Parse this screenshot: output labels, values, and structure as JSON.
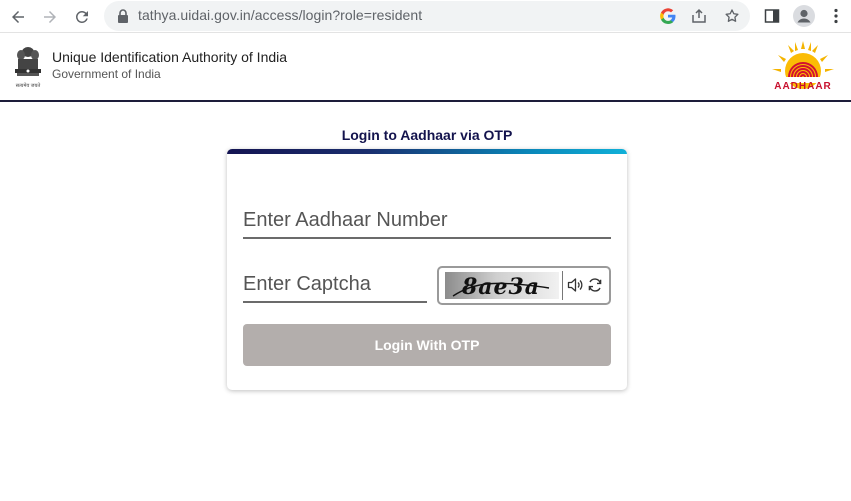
{
  "browser": {
    "url": "tathya.uidai.gov.in/access/login?role=resident",
    "icons": [
      "back-icon",
      "forward-icon",
      "reload-icon",
      "lock-icon",
      "google-icon",
      "share-icon",
      "star-icon",
      "side-panel-icon",
      "profile-icon",
      "menu-icon"
    ]
  },
  "header": {
    "org_name": "Unique Identification Authority of India",
    "org_sub": "Government of India",
    "emblem_caption": "सत्यमेव जयते",
    "logo_text": "AADHAAR",
    "border_color": "#1d1d3a"
  },
  "login": {
    "title": "Login to Aadhaar via OTP",
    "aadhaar_placeholder": "Enter Aadhaar Number",
    "captcha_placeholder": "Enter Captcha",
    "captcha_text": "8ae3a",
    "button_label": "Login With OTP",
    "button_color": "#b3aeac",
    "title_color": "#13134d"
  }
}
